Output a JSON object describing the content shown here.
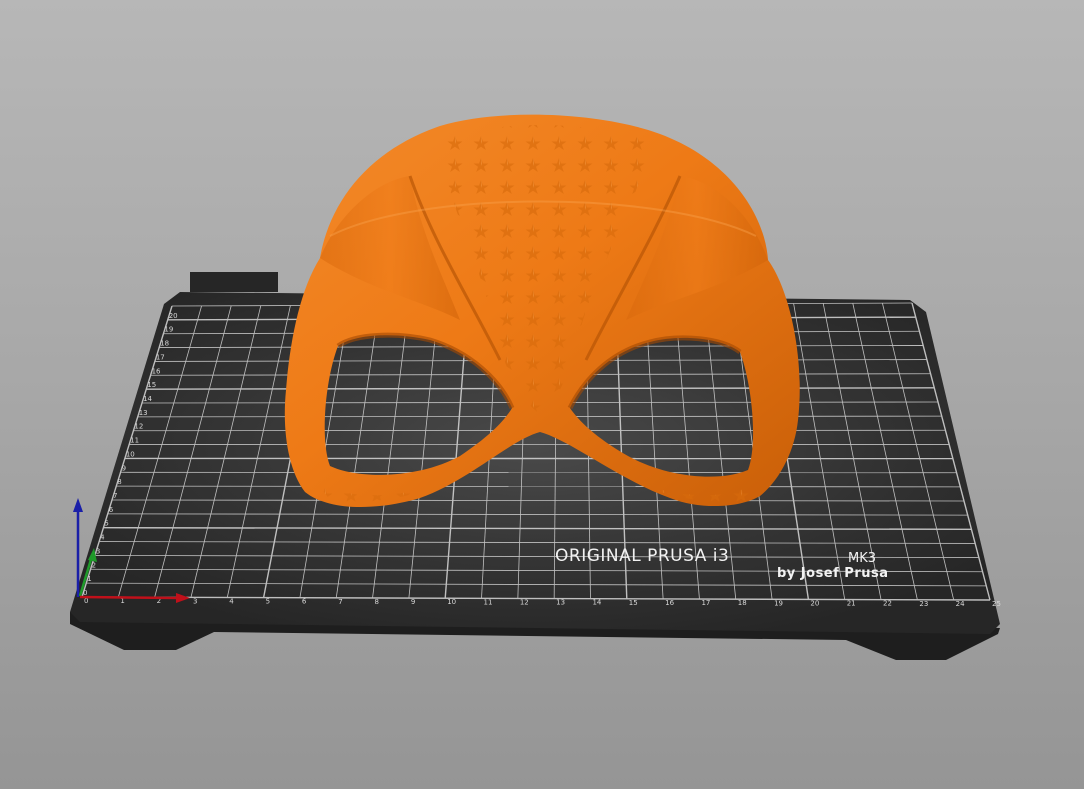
{
  "scene": {
    "background_top": "#b7b7b7",
    "background_bottom": "#959595",
    "bed_color": "#2d2d2d",
    "grid_color": "#d9d9d9",
    "model_color": "#f07d1a",
    "x_axis_color": "#c0101a",
    "y_axis_color": "#1f9a2a",
    "z_axis_color": "#1a1fa8"
  },
  "bed": {
    "brand_line1": "ORIGINAL PRUSA i3",
    "brand_model": "MK3",
    "brand_line2": "by Josef Prusa",
    "x_ticks": [
      "0",
      "1",
      "2",
      "3",
      "4",
      "5",
      "6",
      "7",
      "8",
      "9",
      "10",
      "11",
      "12",
      "13",
      "14",
      "15",
      "16",
      "17",
      "18",
      "19",
      "20",
      "21",
      "22",
      "23",
      "24",
      "25"
    ],
    "y_ticks": [
      "0",
      "1",
      "2",
      "3",
      "4",
      "5",
      "6",
      "7",
      "8",
      "9",
      "10",
      "11",
      "12",
      "13",
      "14",
      "15",
      "16",
      "17",
      "18",
      "19",
      "20"
    ]
  },
  "model": {
    "icon": "mask-model-icon"
  }
}
